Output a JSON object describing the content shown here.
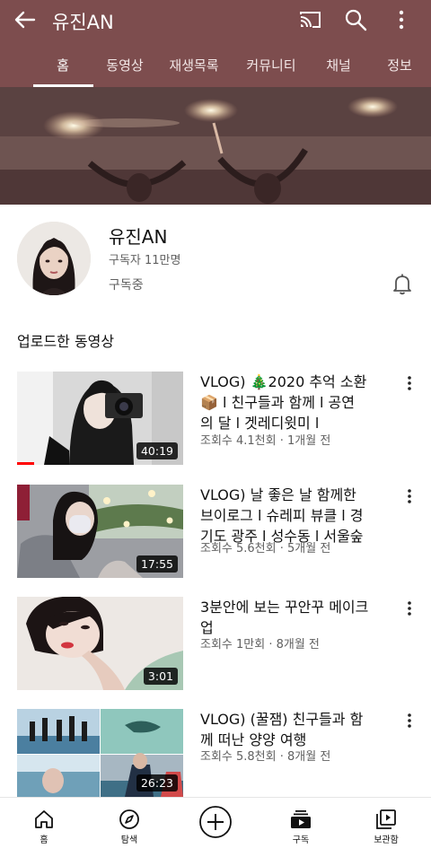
{
  "header": {
    "title": "유진AN",
    "back_icon": "arrow-left-icon",
    "icons": [
      "cast-icon",
      "search-icon",
      "more-vertical-icon"
    ],
    "background": "#7d4d4e"
  },
  "tabs": [
    {
      "label": "홈",
      "active": true
    },
    {
      "label": "동영상",
      "active": false
    },
    {
      "label": "재생목록",
      "active": false
    },
    {
      "label": "커뮤니티",
      "active": false
    },
    {
      "label": "채널",
      "active": false
    },
    {
      "label": "정보",
      "active": false
    }
  ],
  "channel": {
    "name": "유진AN",
    "subscribers": "구독자 11만명",
    "subscribed_label": "구독중"
  },
  "section": {
    "title": "업로드한 동영상"
  },
  "videos": [
    {
      "title_a": "VLOG) 🎄2020 추억 소환",
      "title_b": "📦 l 친구들과 함께 l 공연",
      "title_c": "의 달 l 겟레디윗미 l",
      "meta": "조회수 4.1천회 · 1개월 전",
      "duration": "40:19",
      "watched": 0.1
    },
    {
      "title_a": "VLOG)  날 좋은 날 함께한",
      "title_b": "브이로그 l 슈레피 뷰클 l 경",
      "title_c": "기도 광주 l 성수동 l 서울숲",
      "meta": "조회수 5.6천회 · 5개월 전",
      "duration": "17:55"
    },
    {
      "title_a": "3분안에 보는 꾸안꾸 메이크",
      "title_b": "업",
      "meta": "조회수 1만회 · 8개월 전",
      "duration": "3:01"
    },
    {
      "title_a": "VLOG) (꿀잼) 친구들과 함",
      "title_b": "께 떠난 양양 여행",
      "meta": "조회수 5.8천회 · 8개월 전",
      "duration": "26:23"
    }
  ],
  "bottom_nav": [
    {
      "label": "홈",
      "icon": "home-icon"
    },
    {
      "label": "탐색",
      "icon": "compass-icon"
    },
    {
      "label": "",
      "icon": "create-plus-icon"
    },
    {
      "label": "구독",
      "icon": "subscriptions-icon"
    },
    {
      "label": "보관함",
      "icon": "library-icon"
    }
  ]
}
